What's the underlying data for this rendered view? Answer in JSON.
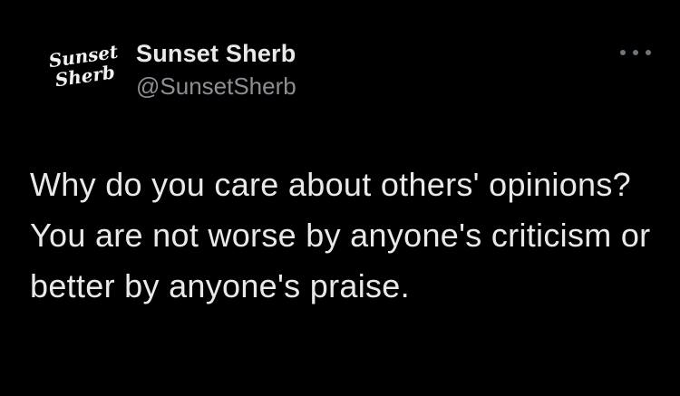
{
  "account": {
    "avatar_logo_lines": [
      "Sunset",
      "Sherb"
    ],
    "display_name": "Sunset Sherb",
    "handle": "@SunsetSherb"
  },
  "tweet": {
    "text": "Why do you care about others' opinions? You are not worse by anyone's criticism or better by anyone's praise."
  },
  "icons": {
    "more": "more-options-icon"
  },
  "colors": {
    "background": "#000000",
    "primary_text": "#e7e9ea",
    "secondary_text": "#8b8f94",
    "icon_gray": "#6e767d"
  }
}
